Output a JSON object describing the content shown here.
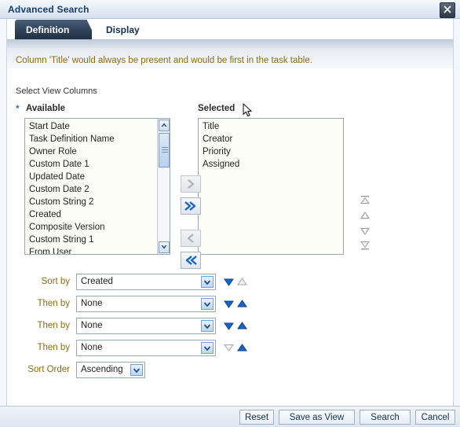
{
  "window": {
    "title": "Advanced Search",
    "close_icon": "close-icon"
  },
  "tabs": [
    {
      "label": "Definition",
      "active": false
    },
    {
      "label": "Display",
      "active": true
    }
  ],
  "message": {
    "text": "Column 'Title' would always be present and would be first in the task table.",
    "color": "#8a6d12"
  },
  "shuttle": {
    "section_label": "Select View Columns",
    "required_marker": "*",
    "available_header": "Available",
    "selected_header": "Selected",
    "available_items": [
      "Start Date",
      "Task Definition Name",
      "Owner Role",
      "Custom Date 1",
      "Updated Date",
      "Custom Date 2",
      "Custom String 2",
      "Created",
      "Composite Version",
      "Custom String 1",
      "From User"
    ],
    "selected_items": [
      "Title",
      "Creator",
      "Priority",
      "Assigned"
    ],
    "transfer_buttons": [
      {
        "name": "move-right-button",
        "icon": "chevron-right-icon",
        "enabled": false
      },
      {
        "name": "move-all-right-button",
        "icon": "double-chevron-right-icon",
        "enabled": true
      },
      {
        "name": "move-left-button",
        "icon": "chevron-left-icon",
        "enabled": false
      },
      {
        "name": "move-all-left-button",
        "icon": "double-chevron-left-icon",
        "enabled": true
      }
    ],
    "reorder_buttons": [
      {
        "name": "move-to-top-button",
        "icon": "move-to-top-icon",
        "enabled": false
      },
      {
        "name": "move-up-button",
        "icon": "move-up-icon",
        "enabled": false
      },
      {
        "name": "move-down-button",
        "icon": "move-down-icon",
        "enabled": false
      },
      {
        "name": "move-to-bottom-button",
        "icon": "move-to-bottom-icon",
        "enabled": false
      }
    ],
    "scrollbar": {
      "up_icon": "scroll-up-icon",
      "down_icon": "scroll-down-icon"
    }
  },
  "sort": {
    "rows": [
      {
        "label": "Sort by",
        "value": "Created",
        "down_enabled": true,
        "up_enabled": false
      },
      {
        "label": "Then by",
        "value": "None",
        "down_enabled": true,
        "up_enabled": true
      },
      {
        "label": "Then by",
        "value": "None",
        "down_enabled": true,
        "up_enabled": true
      },
      {
        "label": "Then by",
        "value": "None",
        "down_enabled": false,
        "up_enabled": true
      }
    ],
    "order": {
      "label": "Sort Order",
      "value": "Ascending"
    },
    "dropdown_icon": "chevron-down-icon"
  },
  "footer": {
    "buttons": [
      {
        "label": "Reset"
      },
      {
        "label": "Save as View"
      },
      {
        "label": "Search"
      },
      {
        "label": "Cancel"
      }
    ]
  },
  "colors": {
    "title_text": "#153d6b",
    "message_text": "#8a6d12",
    "accent_blue": "#1565c8",
    "disabled_grey": "#b9b9b9"
  }
}
